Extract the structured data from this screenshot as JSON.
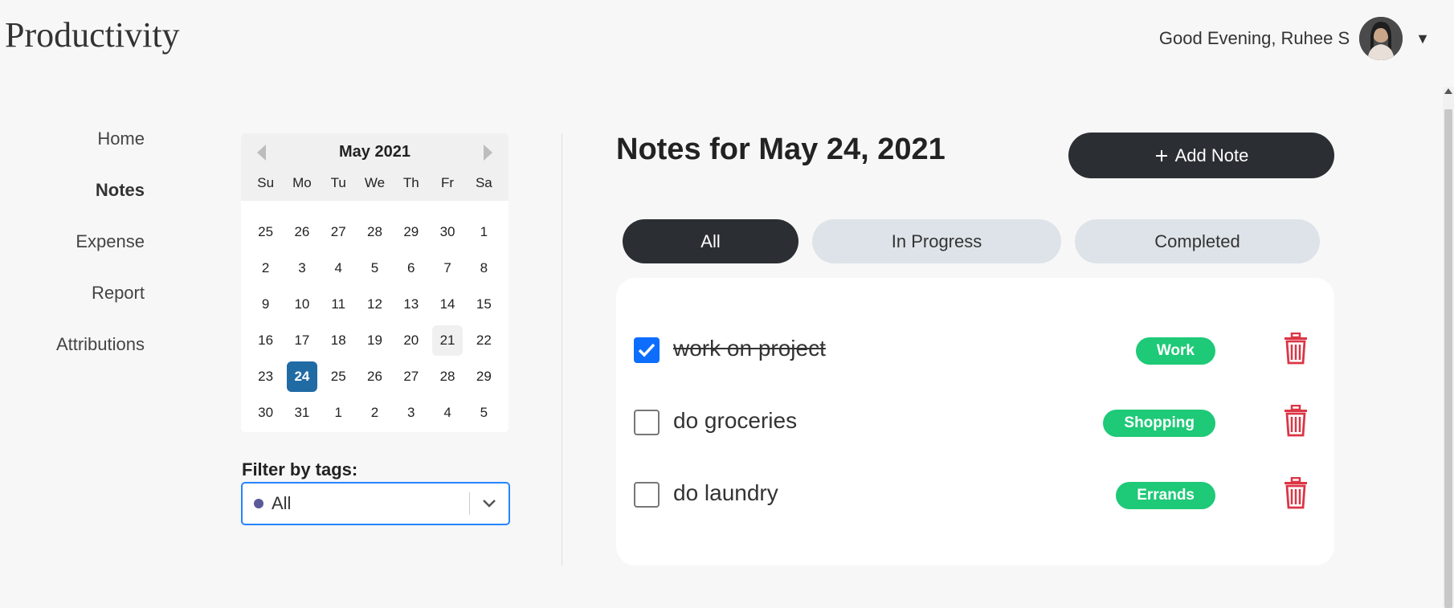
{
  "app": {
    "title": "Productivity"
  },
  "header": {
    "greeting": "Good Evening, Ruhee S"
  },
  "nav": {
    "items": [
      {
        "label": "Home",
        "active": false
      },
      {
        "label": "Notes",
        "active": true
      },
      {
        "label": "Expense",
        "active": false
      },
      {
        "label": "Report",
        "active": false
      },
      {
        "label": "Attributions",
        "active": false
      }
    ]
  },
  "calendar": {
    "month_label": "May 2021",
    "weekdays": [
      "Su",
      "Mo",
      "Tu",
      "We",
      "Th",
      "Fr",
      "Sa"
    ],
    "days": [
      "25",
      "26",
      "27",
      "28",
      "29",
      "30",
      "1",
      "2",
      "3",
      "4",
      "5",
      "6",
      "7",
      "8",
      "9",
      "10",
      "11",
      "12",
      "13",
      "14",
      "15",
      "16",
      "17",
      "18",
      "19",
      "20",
      "21",
      "22",
      "23",
      "24",
      "25",
      "26",
      "27",
      "28",
      "29",
      "30",
      "31",
      "1",
      "2",
      "3",
      "4",
      "5"
    ],
    "selected_day": "24",
    "hovered_day": "21"
  },
  "filter": {
    "label": "Filter by tags:",
    "value": "All"
  },
  "notes": {
    "title": "Notes for May 24, 2021",
    "add_label": "Add Note",
    "tabs": [
      {
        "label": "All",
        "active": true
      },
      {
        "label": "In Progress",
        "active": false
      },
      {
        "label": "Completed",
        "active": false
      }
    ],
    "items": [
      {
        "text": "work on project",
        "done": true,
        "tag": "Work"
      },
      {
        "text": "do groceries",
        "done": false,
        "tag": "Shopping"
      },
      {
        "text": "do laundry",
        "done": false,
        "tag": "Errands"
      }
    ]
  },
  "colors": {
    "accent_dark": "#2b2f33",
    "selected_day": "#216ba5",
    "tag_green": "#1ec977",
    "trash_red": "#dc3545",
    "checkbox_blue": "#0d6efd"
  },
  "icons": [
    "avatar",
    "caret-down-icon",
    "prev-month-icon",
    "next-month-icon",
    "chevron-down-icon",
    "plus-icon",
    "check-icon",
    "trash-icon",
    "tag-color-dot"
  ]
}
